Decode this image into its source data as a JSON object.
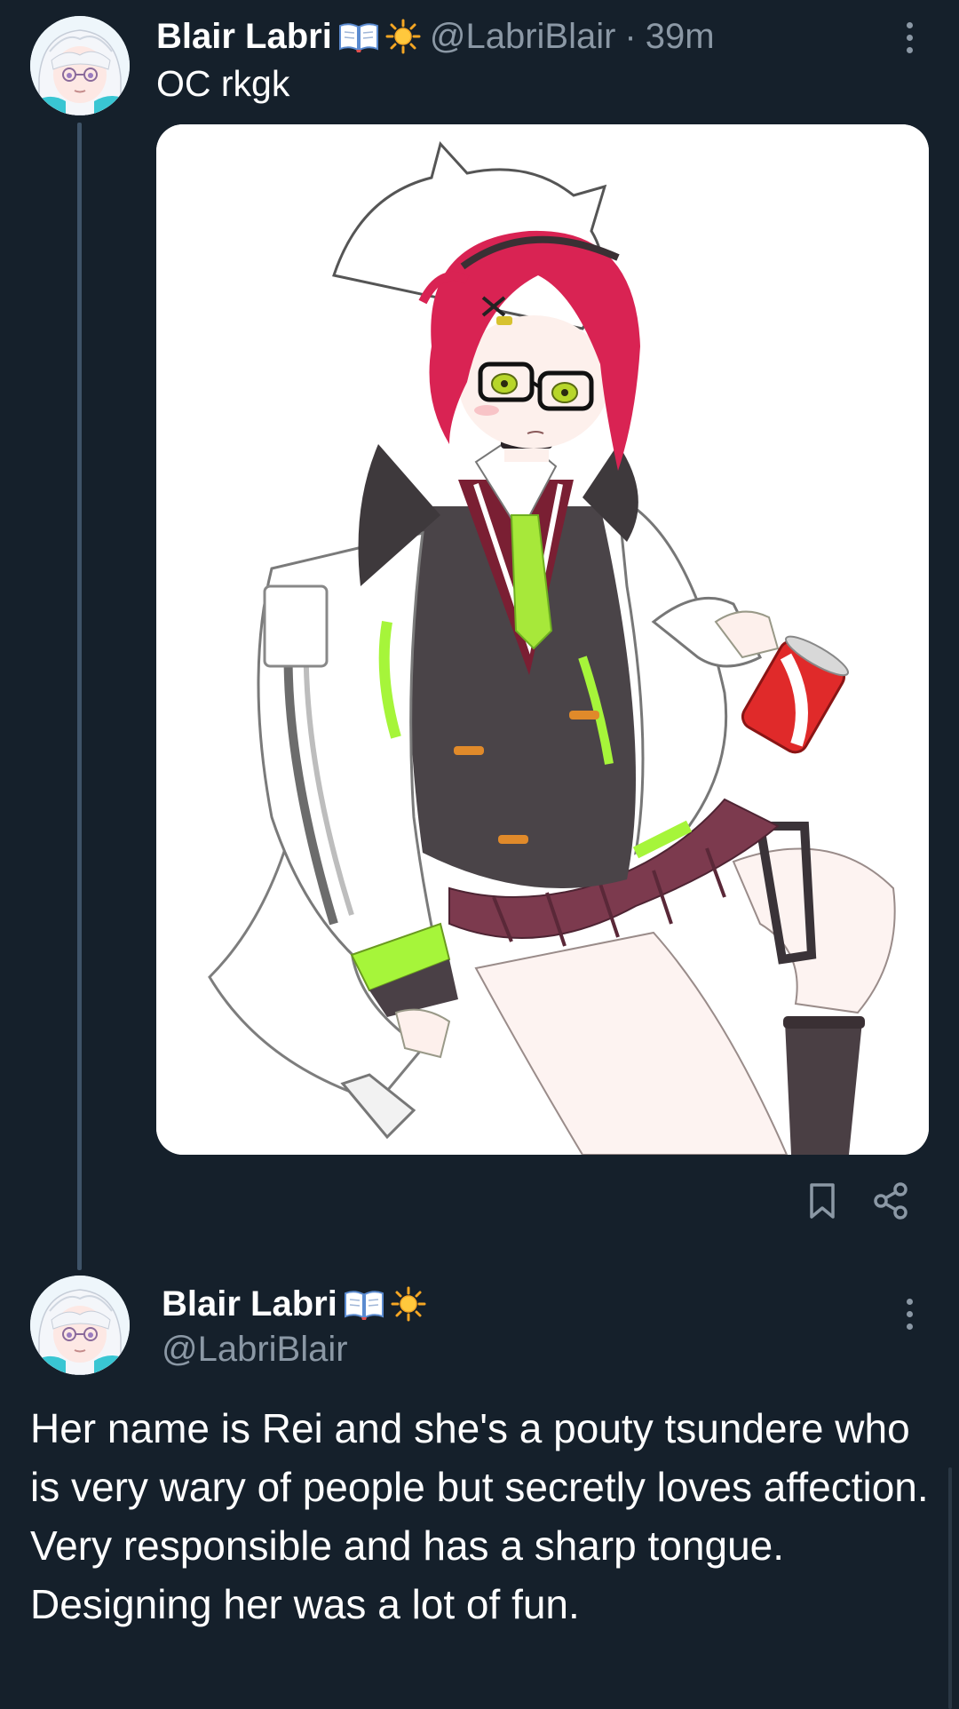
{
  "post1": {
    "author_name": "Blair Labri",
    "author_emoji": [
      "open-book-icon",
      "sun-icon"
    ],
    "handle": "@LabriBlair",
    "separator": "·",
    "time": "39m",
    "text": "OC rkgk",
    "media_alt": "Illustration of a red-haired anime girl with glasses in a white cat-ear hood, holding a can"
  },
  "post1_actions": {
    "bookmark_icon": "bookmark-icon",
    "share_icon": "share-icon"
  },
  "post2": {
    "author_name": "Blair Labri",
    "author_emoji": [
      "open-book-icon",
      "sun-icon"
    ],
    "handle": "@LabriBlair",
    "text": "Her name is Rei and she's a pouty tsundere who is very wary of people but secretly loves affection. Very responsible and has a sharp tongue. Designing her was a lot of fun."
  },
  "colors": {
    "background": "#15202b",
    "text_primary": "#ffffff",
    "text_secondary": "#8b98a5",
    "thread_line": "#3e5368"
  }
}
